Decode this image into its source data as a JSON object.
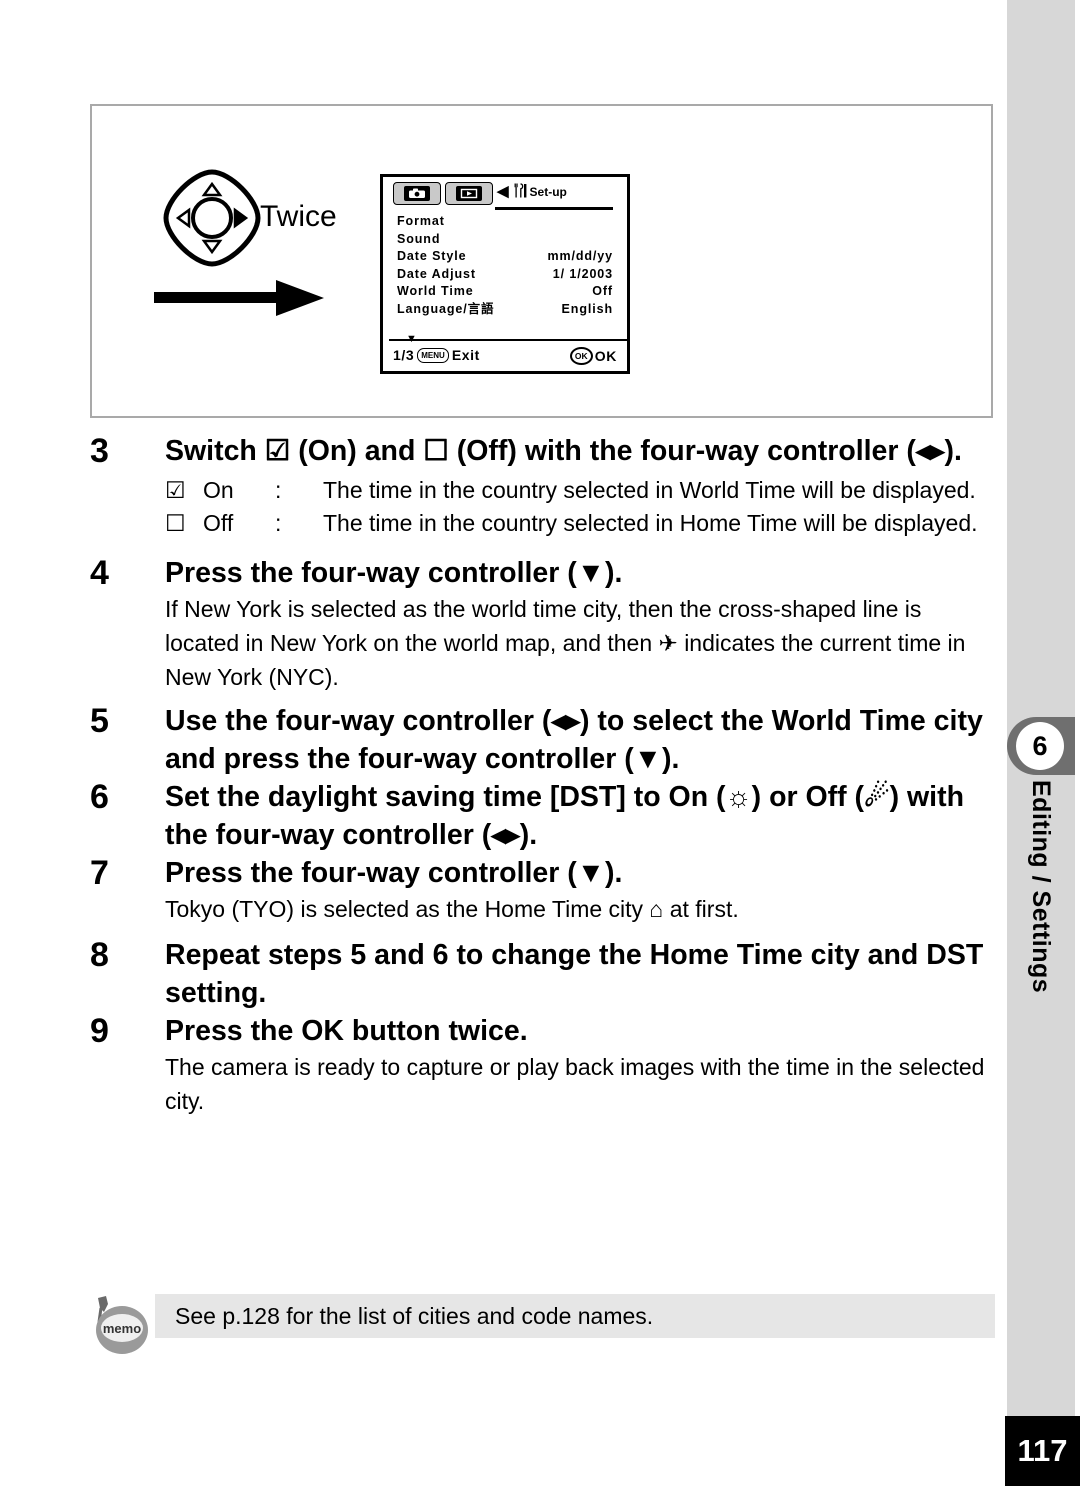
{
  "page": {
    "number": "117",
    "chapter_number": "6",
    "chapter_label": "Editing / Settings"
  },
  "figure": {
    "controller_caption": "Twice",
    "lcd": {
      "tabs": [
        {
          "name": "capture-tab",
          "icon": "camera-icon"
        },
        {
          "name": "playback-tab",
          "icon": "play-icon"
        },
        {
          "name": "setup-tab",
          "icon": "wrench-icon",
          "label": "Set-up"
        }
      ],
      "menu_items": [
        {
          "label": "Format",
          "value": ""
        },
        {
          "label": "Sound",
          "value": ""
        },
        {
          "label": "Date Style",
          "value": "mm/dd/yy"
        },
        {
          "label": "Date Adjust",
          "value": "1/ 1/2003"
        },
        {
          "label": "World Time",
          "value": "Off"
        },
        {
          "label": "Language/言語",
          "value": "English"
        }
      ],
      "scroll_indicator": "▼",
      "page_indicator": "1/3",
      "menu_button": "MENU",
      "exit_label": "Exit",
      "ok_button": "OK",
      "ok_label": "OK"
    }
  },
  "steps": [
    {
      "number": "3",
      "heading": "Switch ☑ (On) and ☐ (Off) with the four-way controller (◂▸).",
      "sublist": [
        {
          "mark": "☑",
          "name": "On",
          "colon": ":",
          "text": "The time in the country selected in World Time will be displayed."
        },
        {
          "mark": "☐",
          "name": "Off",
          "colon": ":",
          "text": "The time in the country selected in Home Time will be displayed."
        }
      ],
      "body": ""
    },
    {
      "number": "4",
      "heading": "Press the four-way controller (▼).",
      "body": "If New York is selected as the world time city, then the cross-shaped line is located in New York on the world map, and then ✈ indicates the current time in New York (NYC)."
    },
    {
      "number": "5",
      "heading": "Use the four-way controller (◂▸) to select the World Time city and press the four-way controller (▼).",
      "body": ""
    },
    {
      "number": "6",
      "heading": "Set the daylight saving time [DST] to On (☼) or Off (☄) with the four-way controller (◂▸).",
      "body": ""
    },
    {
      "number": "7",
      "heading": "Press the four-way controller (▼).",
      "body": "Tokyo (TYO) is selected as the Home Time city ⌂ at first."
    },
    {
      "number": "8",
      "heading": "Repeat steps 5 and 6 to change the Home Time city and DST setting.",
      "body": ""
    },
    {
      "number": "9",
      "heading": "Press the OK button twice.",
      "body": "The camera is ready to capture or play back images with the time in the selected city."
    }
  ],
  "memo": {
    "icon_label": "memo",
    "text": "See p.128 for the list of cities and code names."
  }
}
